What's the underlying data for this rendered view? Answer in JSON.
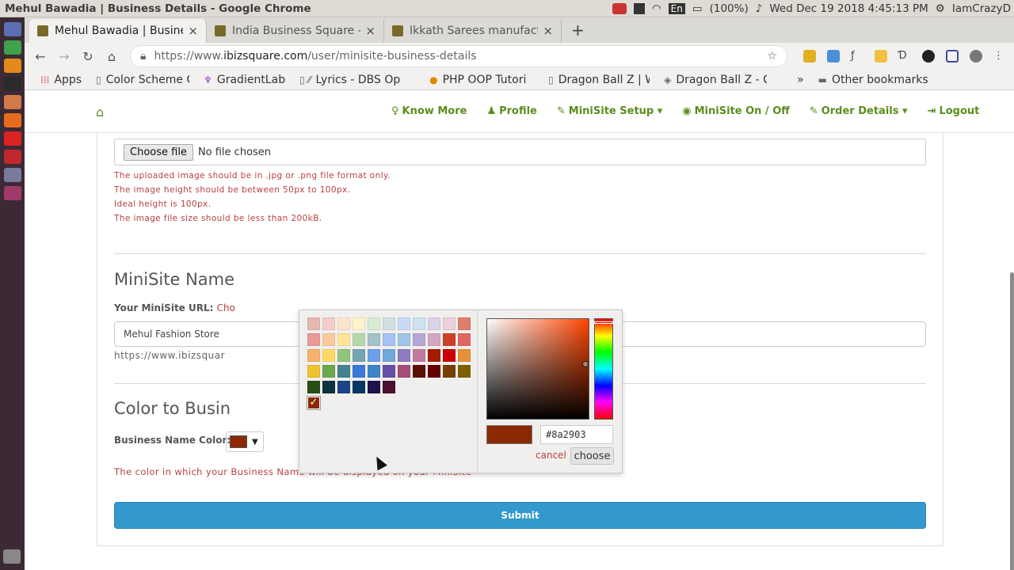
{
  "system": {
    "window_title": "Mehul Bawadia | Business Details - Google Chrome",
    "battery": "(100%)",
    "keyboard": "En",
    "datetime": "Wed Dec 19 2018  4:45:13 PM",
    "username": "IamCrazyD"
  },
  "browser": {
    "tabs": [
      {
        "title": "Mehul Bawadia | Business",
        "active": true
      },
      {
        "title": "India Business Square - a",
        "active": false
      },
      {
        "title": "Ikkath Sarees manufacture",
        "active": false
      }
    ],
    "url_prefix": "https://www.",
    "url_domain": "ibizsquare.com",
    "url_path": "/user/minisite-business-details",
    "bookmarks": [
      "Apps",
      "Color Scheme G",
      "GradientLab",
      "Lyrics - DBS Op",
      "PHP OOP Tutori",
      "Dragon Ball Z | W",
      "Dragon Ball Z - C"
    ],
    "bookmarks_more": "»",
    "other_bookmarks": "Other bookmarks"
  },
  "site_nav": {
    "items": [
      {
        "label": "Know More",
        "glyph": "♀"
      },
      {
        "label": "Profile",
        "glyph": "♟"
      },
      {
        "label": "MiniSite Setup",
        "glyph": "✎",
        "dropdown": true
      },
      {
        "label": "MiniSite On / Off",
        "glyph": "◉"
      },
      {
        "label": "Order Details",
        "glyph": "✎",
        "dropdown": true
      },
      {
        "label": "Logout",
        "glyph": "⇥"
      }
    ]
  },
  "form": {
    "choose_file_label": "Choose file",
    "no_file_text": "No file chosen",
    "hints": [
      "The uploaded image should be in .jpg or .png file format only.",
      "The image height should be between 50px to 100px.",
      "Ideal height is 100px.",
      "The image file size should be less than 200kB."
    ],
    "minisite_heading": "MiniSite Name",
    "minisite_url_label": "Your MiniSite URL:",
    "minisite_url_link": "Cho",
    "minisite_name_value": "Mehul Fashion Store",
    "minisite_url_text": "https://www.ibizsquar",
    "color_heading": "Color to Busin",
    "business_color_label": "Business Name Color:",
    "color_hint": "The color in which your Business Name will be displayed on your MiniSite",
    "submit_label": "Submit",
    "selected_color": "#8a2903"
  },
  "color_picker": {
    "hex_value": "#8a2903",
    "cancel_label": "cancel",
    "choose_label": "choose",
    "palette": [
      [
        "#e6b8af",
        "#f4cccc",
        "#fce5cd",
        "#fff2cc",
        "#d9ead3",
        "#d0e0e3",
        "#c9daf8",
        "#cfe2f3",
        "#d9d2e9",
        "#ead1dc",
        "#dd7e6b"
      ],
      [
        "#ea9999",
        "#f9cb9c",
        "#ffe599",
        "#b6d7a8",
        "#a2c4c9",
        "#a4c2f4",
        "#9fc5e8",
        "#b4a7d6",
        "#d5a6bd",
        "#cc4125",
        "#e06666"
      ],
      [
        "#f6b26b",
        "#ffd966",
        "#93c47d",
        "#76a5af",
        "#6d9eeb",
        "#6fa8dc",
        "#8e7cc3",
        "#c27ba0",
        "#a61c00",
        "#cc0000",
        "#e69138"
      ],
      [
        "#f1c232",
        "#6aa84f",
        "#45818e",
        "#3c78d8",
        "#3d85c6",
        "#674ea7",
        "#a64d79",
        "#5b0f00",
        "#660000",
        "#783f04",
        "#7f6000"
      ],
      [
        "#274e13",
        "#0c343d",
        "#1c4587",
        "#073763",
        "#20124d",
        "#4c1130"
      ],
      [
        "#8a2903"
      ]
    ]
  }
}
